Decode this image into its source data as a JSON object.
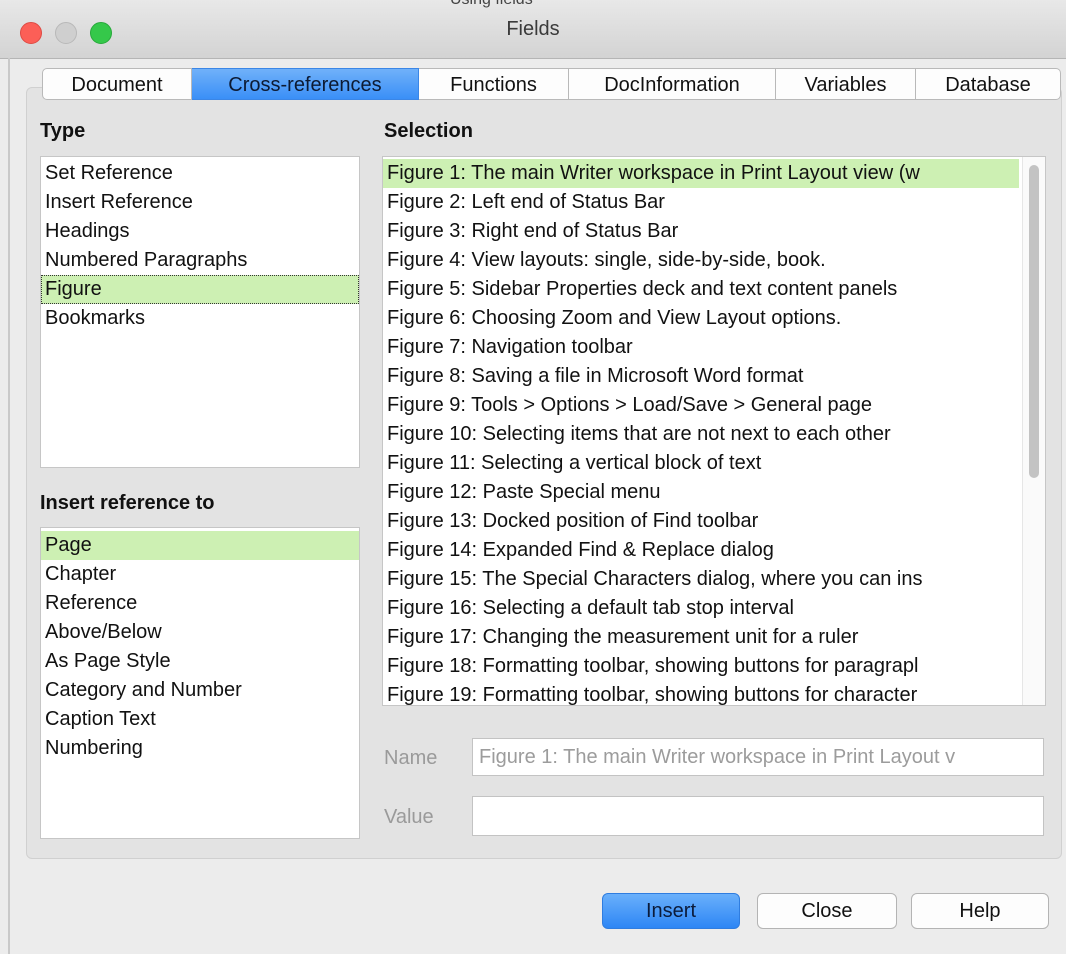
{
  "window": {
    "title": "Fields",
    "behind_text": "Using fields"
  },
  "tabs": [
    {
      "label": "Document",
      "active": false
    },
    {
      "label": "Cross-references",
      "active": true
    },
    {
      "label": "Functions",
      "active": false
    },
    {
      "label": "DocInformation",
      "active": false
    },
    {
      "label": "Variables",
      "active": false
    },
    {
      "label": "Database",
      "active": false
    }
  ],
  "type": {
    "label": "Type",
    "items": [
      "Set Reference",
      "Insert Reference",
      "Headings",
      "Numbered Paragraphs",
      "Figure",
      "Bookmarks"
    ],
    "selected": "Figure"
  },
  "insert_ref": {
    "label": "Insert reference to",
    "items": [
      "Page",
      "Chapter",
      "Reference",
      "Above/Below",
      "As Page Style",
      "Category and Number",
      "Caption Text",
      "Numbering"
    ],
    "selected": "Page"
  },
  "selection": {
    "label": "Selection",
    "items": [
      "Figure 1: The main Writer workspace in Print Layout view (w",
      "Figure 2: Left end of Status Bar",
      "Figure 3: Right end of Status Bar",
      "Figure 4: View layouts: single, side-by-side, book.",
      "Figure 5: Sidebar Properties deck and text content panels",
      "Figure 6: Choosing Zoom and View Layout options.",
      "Figure 7: Navigation toolbar",
      "Figure 8: Saving a file in Microsoft Word format",
      "Figure 9: Tools > Options > Load/Save > General page",
      "Figure 10: Selecting items that are not next to each other",
      "Figure 11: Selecting a vertical block of text",
      "Figure 12: Paste Special menu",
      "Figure 13: Docked position of Find toolbar",
      "Figure 14: Expanded Find & Replace dialog",
      "Figure 15: The Special Characters dialog, where you can ins",
      "Figure 16: Selecting a default tab stop interval",
      "Figure 17: Changing the measurement unit for a ruler",
      "Figure 18: Formatting toolbar, showing buttons for paragrapl",
      "Figure 19: Formatting toolbar, showing buttons for character"
    ],
    "selected_index": 0
  },
  "name_field": {
    "label": "Name",
    "value": "Figure 1: The main Writer workspace in Print Layout v"
  },
  "value_field": {
    "label": "Value",
    "value": ""
  },
  "buttons": {
    "insert": "Insert",
    "close": "Close",
    "help": "Help"
  },
  "colors": {
    "tab_active": "#3a8ff7",
    "selection_highlight": "#cdf0b3",
    "close_dot": "#fc5f57",
    "max_dot": "#35c84a"
  }
}
